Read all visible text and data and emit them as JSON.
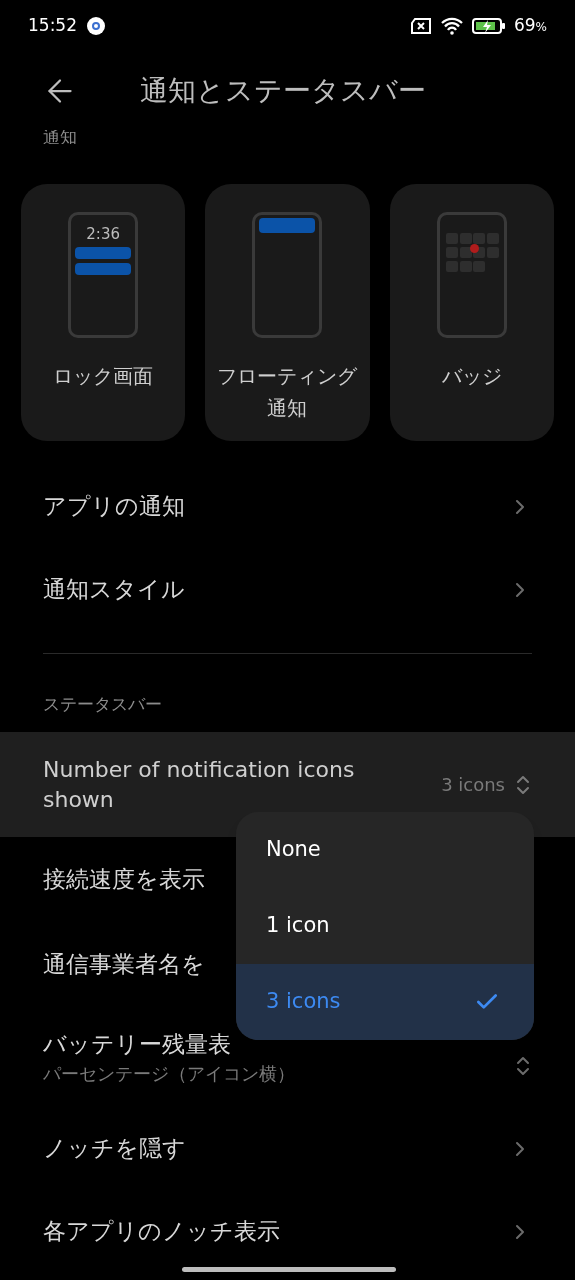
{
  "status_bar": {
    "time": "15:52",
    "battery_percent": "69",
    "percent_sign": "%"
  },
  "header": {
    "title": "通知とステータスバー"
  },
  "notifications": {
    "label": "通知",
    "cards": [
      {
        "kind": "lock",
        "label_lines": [
          "ロック画面"
        ],
        "clock": "2:36"
      },
      {
        "kind": "floating",
        "label_lines": [
          "フローティング",
          "通知"
        ]
      },
      {
        "kind": "badge",
        "label_lines": [
          "バッジ"
        ]
      }
    ],
    "rows": [
      {
        "label": "アプリの通知"
      },
      {
        "label": "通知スタイル"
      }
    ]
  },
  "status_section": {
    "label": "ステータスバー",
    "rows": [
      {
        "kind": "select",
        "label": "Number of notification icons shown",
        "value": "3 icons",
        "highlighted": true
      },
      {
        "kind": "covered",
        "label": "接続速度を表示",
        "highlighted": false
      },
      {
        "kind": "covered",
        "label": "通信事業者名を",
        "highlighted": false
      },
      {
        "kind": "select_sub",
        "label": "バッテリー残量表",
        "subtitle": "パーセンテージ（アイコン横）",
        "highlighted": false
      },
      {
        "kind": "link",
        "label": "ノッチを隠す",
        "highlighted": false
      },
      {
        "kind": "link",
        "label": "各アプリのノッチ表示",
        "highlighted": false
      }
    ]
  },
  "dropdown": {
    "options": [
      {
        "label": "None",
        "selected": false
      },
      {
        "label": "1 icon",
        "selected": false
      },
      {
        "label": "3 icons",
        "selected": true
      }
    ]
  }
}
